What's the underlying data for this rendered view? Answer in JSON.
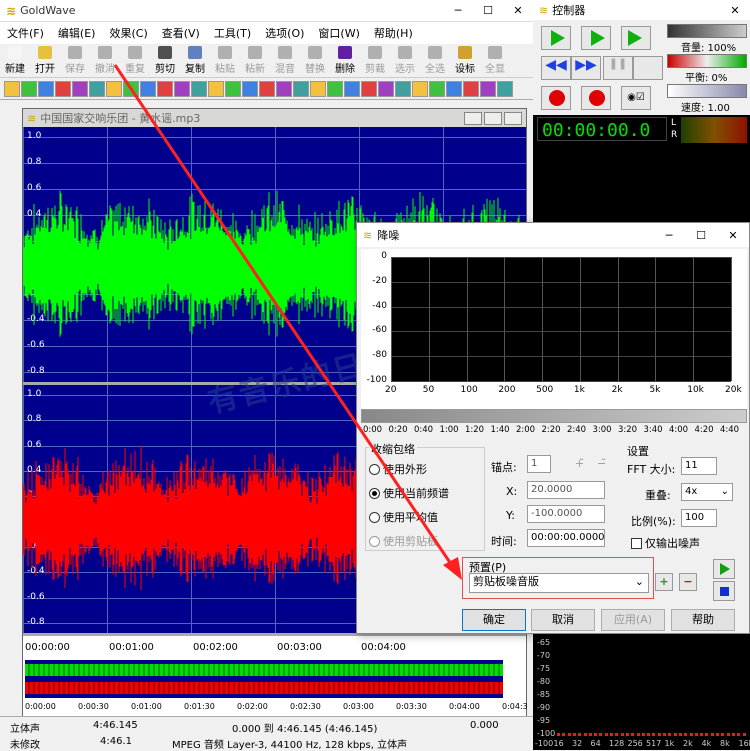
{
  "app": {
    "title": "GoldWave",
    "min": "─",
    "max": "☐",
    "close": "✕"
  },
  "menu": [
    "文件(F)",
    "编辑(E)",
    "效果(C)",
    "查看(V)",
    "工具(T)",
    "选项(O)",
    "窗口(W)",
    "帮助(H)"
  ],
  "toolbar": [
    {
      "label": "新建",
      "dis": false,
      "color": "#f5f5f5"
    },
    {
      "label": "打开",
      "dis": false,
      "color": "#e8c040"
    },
    {
      "label": "保存",
      "dis": true,
      "color": "#b0b0b0"
    },
    {
      "label": "撤消",
      "dis": true,
      "color": "#b0b0b0"
    },
    {
      "label": "重复",
      "dis": true,
      "color": "#b0b0b0"
    },
    {
      "label": "剪切",
      "dis": false,
      "color": "#505050"
    },
    {
      "label": "复制",
      "dis": false,
      "color": "#6080c0"
    },
    {
      "label": "粘贴",
      "dis": true,
      "color": "#b0b0b0"
    },
    {
      "label": "粘新",
      "dis": true,
      "color": "#b0b0b0"
    },
    {
      "label": "混音",
      "dis": true,
      "color": "#b0b0b0"
    },
    {
      "label": "替换",
      "dis": true,
      "color": "#b0b0b0"
    },
    {
      "label": "删除",
      "dis": false,
      "color": "#6020a0"
    },
    {
      "label": "剪裁",
      "dis": true,
      "color": "#b0b0b0"
    },
    {
      "label": "选示",
      "dis": true,
      "color": "#b0b0b0"
    },
    {
      "label": "全选",
      "dis": true,
      "color": "#b0b0b0"
    },
    {
      "label": "设标",
      "dis": false,
      "color": "#d0a030"
    },
    {
      "label": "全显",
      "dis": true,
      "color": "#b0b0b0"
    }
  ],
  "doc": {
    "title": "中国国家交响乐团 - 黄水谣.mp3"
  },
  "wave": {
    "top_labels": [
      "1.0",
      "0.8",
      "0.6",
      "0.4",
      "0.2",
      "0.0",
      "-0.2",
      "-0.4",
      "-0.6",
      "-0.8"
    ],
    "bot_labels": [
      "1.0",
      "0.8",
      "0.6",
      "0.4",
      "0.2",
      "0.0",
      "-0.2",
      "-0.4",
      "-0.6",
      "-0.8"
    ],
    "time_labels": [
      "00:00:00",
      "00:01:00",
      "00:02:00",
      "00:03:00",
      "00:04:00"
    ],
    "overview_labels": [
      "0:00:00",
      "0:00:30",
      "0:01:00",
      "0:01:30",
      "0:02:00",
      "0:02:30",
      "0:03:00",
      "0:03:30",
      "0:04:00",
      "0:04:3"
    ],
    "top_color": "#00ff00",
    "bot_color": "#ff0000"
  },
  "controller": {
    "title": "控制器",
    "volume_label": "音量: 100%",
    "balance_label": "平衡: 0%",
    "speed_label": "速度: 1.00",
    "time": "00:00:00.0",
    "L": "L",
    "R": "R",
    "spectrum_labels": [
      "-65",
      "-70",
      "-75",
      "-80",
      "-85",
      "-90",
      "-95",
      "-100"
    ],
    "spectrum_x": [
      "-100",
      "16",
      "32",
      "64",
      "128",
      "256",
      "517",
      "1k",
      "2k",
      "4k",
      "8k",
      "16k"
    ]
  },
  "dialog": {
    "title": "降噪",
    "y_axis": [
      "0",
      "-20",
      "-40",
      "-60",
      "-80",
      "-100"
    ],
    "x_axis": [
      "20",
      "50",
      "100",
      "200",
      "500",
      "1k",
      "2k",
      "5k",
      "10k",
      "20k"
    ],
    "time_axis": [
      "0:00",
      "0:20",
      "0:40",
      "1:00",
      "1:20",
      "1:40",
      "2:00",
      "2:20",
      "2:40",
      "3:00",
      "3:20",
      "3:40",
      "4:00",
      "4:20",
      "4:40"
    ],
    "group_title": "收缩包络",
    "radios": [
      "使用外形",
      "使用当前频谱",
      "使用平均值",
      "使用剪贴板"
    ],
    "anchor_label": "锚点:",
    "anchor_value": "1",
    "x_label": "X:",
    "x_value": "20.0000",
    "y_label": "Y:",
    "y_value": "-100.0000",
    "time_label": "时间:",
    "time_value": "00:00:00.0000",
    "settings_title": "设置",
    "fft_label": "FFT 大小:",
    "fft_value": "11",
    "overlap_label": "重叠:",
    "overlap_value": "4x",
    "ratio_label": "比例(%):",
    "ratio_value": "100",
    "noise_only": "仅输出噪声",
    "preset_label": "预置(P)",
    "preset_value": "剪贴板噪音版",
    "ok": "确定",
    "cancel": "取消",
    "apply": "应用(A)",
    "help": "帮助"
  },
  "watermark": "有音乐的日子",
  "status": {
    "r1c1": "立体声",
    "r1c2": "4:46.145",
    "r1c3": "0.000 到 4:46.145 (4:46.145)",
    "r1c4": "0.000",
    "r2c1": "未修改",
    "r2c2": "4:46.1",
    "r2c3": "MPEG 音频 Layer-3, 44100 Hz, 128 kbps, 立体声"
  }
}
